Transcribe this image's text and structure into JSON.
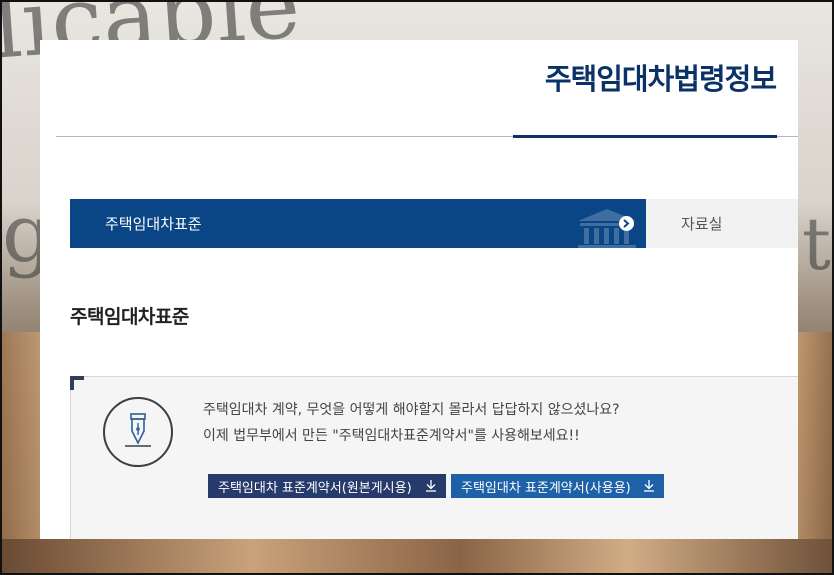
{
  "background": {
    "decor_words": [
      "licable",
      "g",
      "t"
    ]
  },
  "header": {
    "site_title": "주택임대차법령정보"
  },
  "tabs": [
    {
      "label": "주택임대차표준",
      "active": true
    },
    {
      "label": "자료실",
      "active": false
    }
  ],
  "section": {
    "title": "주택임대차표준"
  },
  "info": {
    "line1": "주택임대차 계약, 무엇을 어떻게 해야할지 몰라서 답답하지 않으셨나요?",
    "line2": "이제 법무부에서 만든 \"주택임대차표준계약서\"를 사용해보세요!!",
    "icon": "fountain-pen-icon"
  },
  "downloads": [
    {
      "label": "주택임대차 표준계약서(원본게시용)",
      "icon": "download-icon"
    },
    {
      "label": "주택임대차 표준계약서(사용용)",
      "icon": "download-icon"
    }
  ],
  "colors": {
    "title_navy": "#0b3266",
    "tab_active_bg": "#0a4585",
    "tab_inactive_bg": "#f1f1f1",
    "btn_original_bg": "#263a6b",
    "btn_use_bg": "#1e61a8"
  }
}
